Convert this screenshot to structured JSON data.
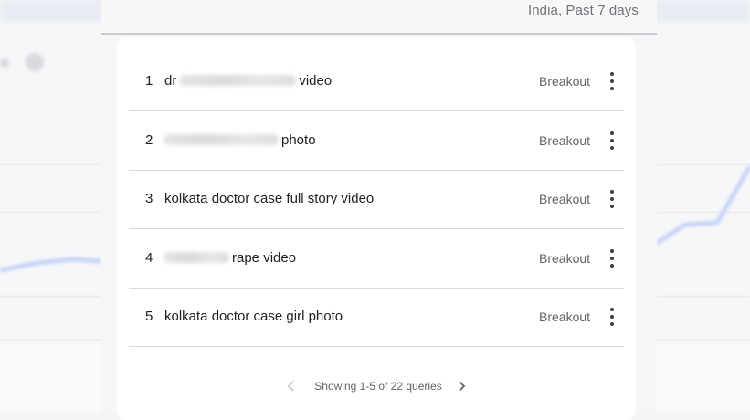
{
  "header": {
    "region_label": "India, Past 7 days"
  },
  "rows": [
    {
      "rank": "1",
      "prefix": "dr",
      "suffix": "video",
      "badge": "Breakout"
    },
    {
      "rank": "2",
      "prefix": "",
      "suffix": "photo",
      "badge": "Breakout"
    },
    {
      "rank": "3",
      "prefix": "kolkata doctor case full story video",
      "suffix": "",
      "badge": "Breakout"
    },
    {
      "rank": "4",
      "prefix": "",
      "suffix": "rape video",
      "badge": "Breakout"
    },
    {
      "rank": "5",
      "prefix": "kolkata doctor case girl photo",
      "suffix": "",
      "badge": "Breakout"
    }
  ],
  "pagination": {
    "label": "Showing 1-5 of 22 queries"
  },
  "icons": {
    "more": "more-vert-icon",
    "prev": "chevron-left-icon",
    "next": "chevron-right-icon"
  },
  "colors": {
    "chart_line": "#c5d3f6",
    "text": "#202124",
    "muted": "#5f6368"
  }
}
